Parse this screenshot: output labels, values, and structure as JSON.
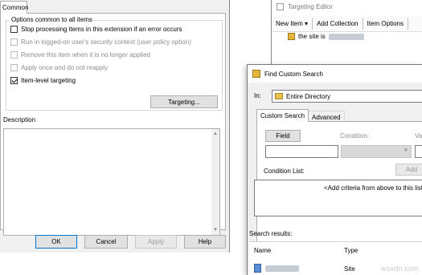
{
  "properties": {
    "tab_common": "Common",
    "group_legend": "Options common to all items",
    "options": [
      {
        "label": "Stop processing items in this extension if an error occurs",
        "checked": false,
        "enabled": true
      },
      {
        "label": "Run in logged-on user's security context (user policy option)",
        "checked": false,
        "enabled": false
      },
      {
        "label": "Remove this item when it is no longer applied",
        "checked": false,
        "enabled": false
      },
      {
        "label": "Apply once and do not reapply",
        "checked": false,
        "enabled": false
      },
      {
        "label": "Item-level targeting",
        "checked": true,
        "enabled": true
      }
    ],
    "targeting_button": "Targeting...",
    "description_label": "Description",
    "buttons": {
      "ok": "OK",
      "cancel": "Cancel",
      "apply": "Apply",
      "help": "Help"
    }
  },
  "targeting_editor": {
    "title": "Targeting Editor",
    "toolbar": {
      "new_item": "New Item ▾",
      "add_collection": "Add Collection",
      "item_options": "Item Options"
    },
    "tree_item": "the site is"
  },
  "find_custom_search": {
    "title": "Find Custom Search",
    "in_label": "In:",
    "in_value": "Entire Directory",
    "tabs": {
      "custom": "Custom Search",
      "advanced": "Advanced"
    },
    "field_button": "Field",
    "condition_label": "Condition:",
    "value_label": "Va",
    "add_button": "Add",
    "condition_list_label": "Condition List:",
    "condition_list_placeholder": "<Add criteria from above to this list>",
    "results_label": "Search results:",
    "columns": {
      "name": "Name",
      "type": "Type"
    },
    "result_type": "Site"
  },
  "watermark": "wsxdn.com"
}
